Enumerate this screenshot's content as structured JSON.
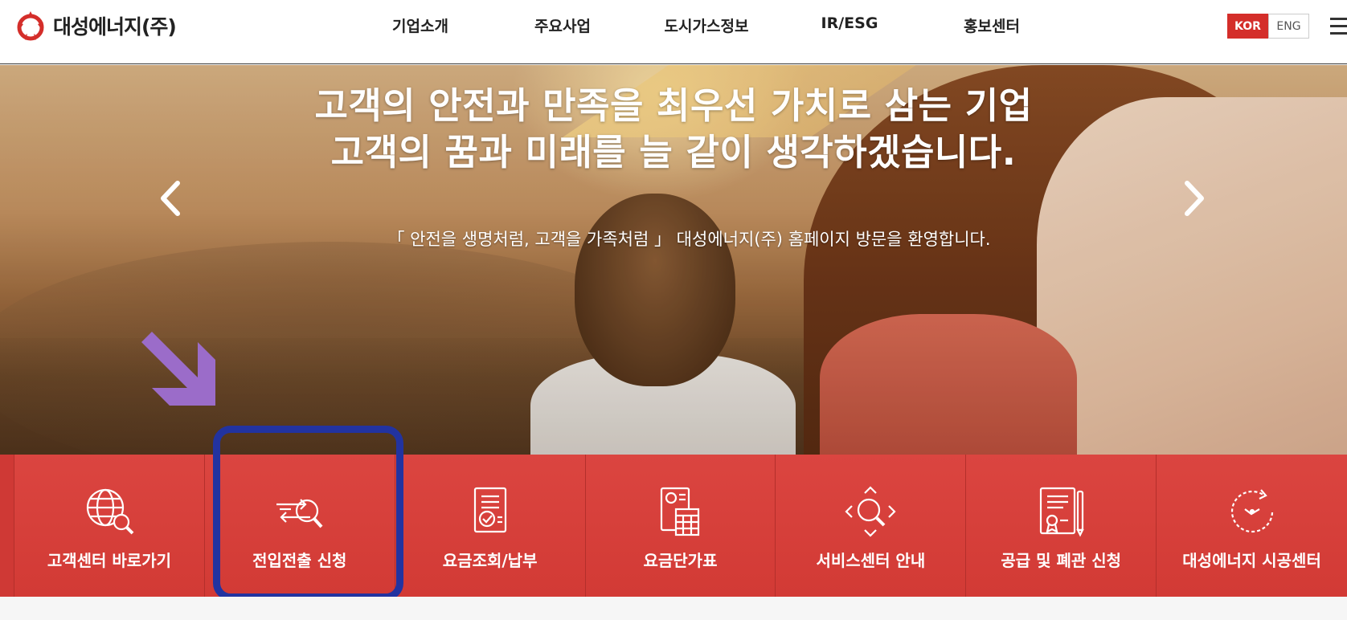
{
  "header": {
    "logo_text": "대성에너지(주)",
    "nav": [
      "기업소개",
      "주요사업",
      "도시가스정보",
      "IR/ESG",
      "홍보센터"
    ],
    "lang": {
      "kor": "KOR",
      "eng": "ENG"
    }
  },
  "hero": {
    "title_line1": "고객의 안전과 만족을 최우선 가치로 삼는 기업",
    "title_line2": "고객의 꿈과 미래를 늘 같이 생각하겠습니다.",
    "subtitle": "「 안전을 생명처럼, 고객을 가족처럼 」  대성에너지(주) 홈페이지 방문을 환영합니다."
  },
  "quick_menu": [
    {
      "label": "고객센터 바로가기",
      "icon": "globe-search-icon"
    },
    {
      "label": "전입전출 신청",
      "icon": "transfer-search-icon"
    },
    {
      "label": "요금조회/납부",
      "icon": "document-check-icon"
    },
    {
      "label": "요금단가표",
      "icon": "calculator-document-icon"
    },
    {
      "label": "서비스센터 안내",
      "icon": "location-search-icon"
    },
    {
      "label": "공급 및 폐관 신청",
      "icon": "certificate-icon"
    },
    {
      "label": "대성에너지 시공센터",
      "icon": "clock-icon"
    }
  ],
  "colors": {
    "brand_red": "#d83f3a",
    "highlight_blue": "#2233a0",
    "pointer_purple": "#9b6cc9"
  }
}
